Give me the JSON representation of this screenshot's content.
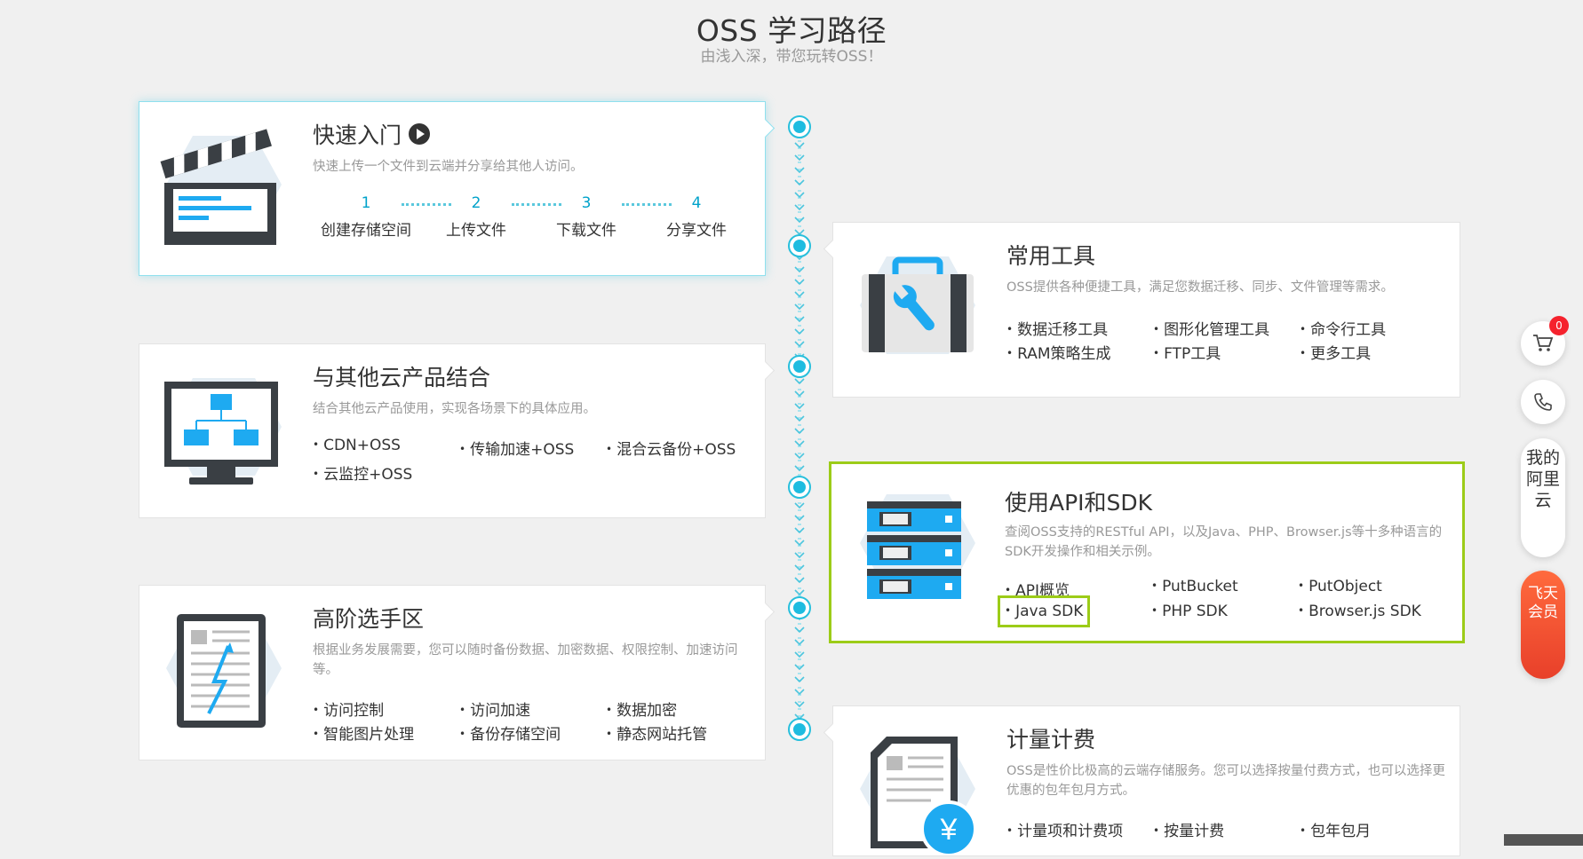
{
  "header": {
    "title": "OSS 学习路径",
    "subtitle": "由浅入深，带您玩转OSS！"
  },
  "cards": {
    "quickstart": {
      "title": "快速入门",
      "desc": "快速上传一个文件到云端并分享给其他人访问。",
      "steps": [
        {
          "num": "1",
          "label": "创建存储空间"
        },
        {
          "num": "2",
          "label": "上传文件"
        },
        {
          "num": "3",
          "label": "下载文件"
        },
        {
          "num": "4",
          "label": "分享文件"
        }
      ]
    },
    "tools": {
      "title": "常用工具",
      "desc": "OSS提供各种便捷工具，满足您数据迁移、同步、文件管理等需求。",
      "links": [
        "数据迁移工具",
        "图形化管理工具",
        "命令行工具",
        "RAM策略生成",
        "FTP工具",
        "更多工具"
      ]
    },
    "integration": {
      "title": "与其他云产品结合",
      "desc": "结合其他云产品使用，实现各场景下的具体应用。",
      "links": [
        "CDN+OSS",
        "传输加速+OSS",
        "混合云备份+OSS",
        "云监控+OSS"
      ]
    },
    "api": {
      "title": "使用API和SDK",
      "desc": "查阅OSS支持的RESTful API，以及Java、PHP、Browser.js等十多种语言的SDK开发操作和相关示例。",
      "links": [
        "API概览",
        "PutBucket",
        "PutObject",
        "Java SDK",
        "PHP SDK",
        "Browser.js SDK"
      ]
    },
    "advanced": {
      "title": "高阶选手区",
      "desc": "根据业务发展需要，您可以随时备份数据、加密数据、权限控制、加速访问等。",
      "links": [
        "访问控制",
        "访问加速",
        "数据加密",
        "智能图片处理",
        "备份存储空间",
        "静态网站托管"
      ]
    },
    "billing": {
      "title": "计量计费",
      "desc": "OSS是性价比极高的云端存储服务。您可以选择按量付费方式，也可以选择更优惠的包年包月方式。",
      "links": [
        "计量项和计费项",
        "按量计费",
        "包年包月"
      ]
    }
  },
  "sidebar": {
    "cart_count": "0",
    "account_label": "我的阿里云",
    "promo_label": "飞天会员"
  },
  "colors": {
    "accent": "#00a2ca",
    "highlight": "#9ccc18",
    "icon_blue": "#1eaaf1",
    "icon_dark": "#3a3f44"
  }
}
